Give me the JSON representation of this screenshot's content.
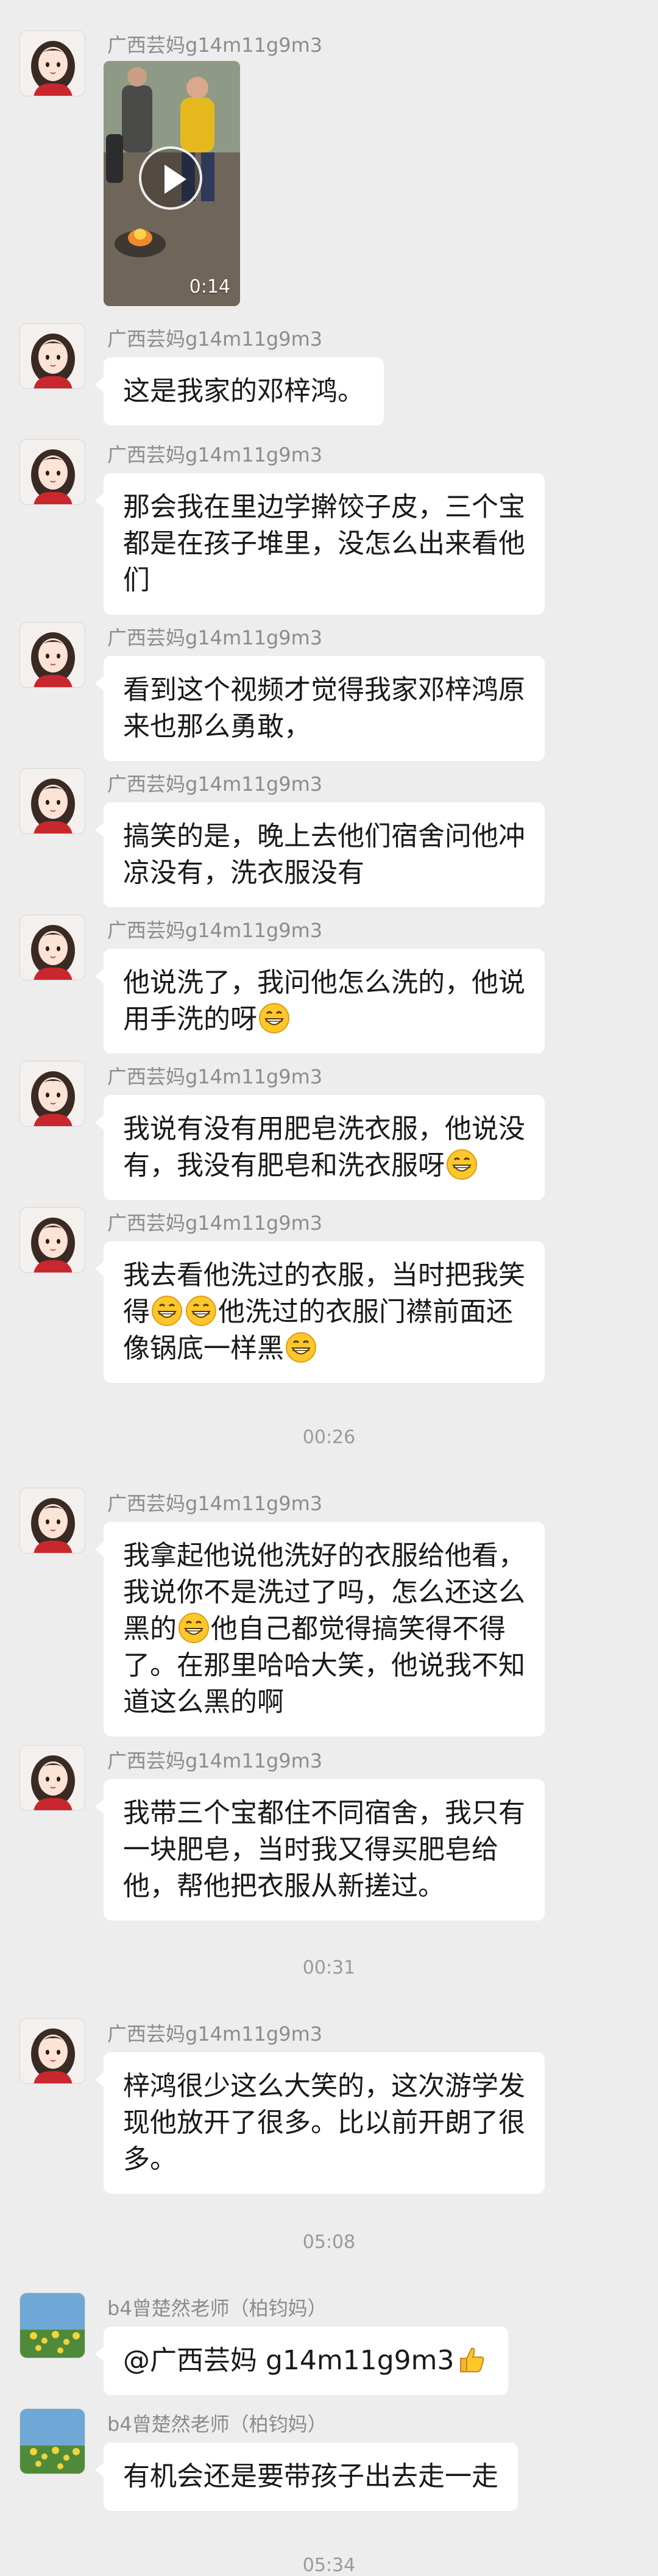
{
  "chat": {
    "background": "#ededed",
    "messages": [
      {
        "type": "video",
        "sender": "广西芸妈g14m11g9m3",
        "duration": "0:14"
      },
      {
        "type": "text",
        "sender": "广西芸妈g14m11g9m3",
        "lines": [
          "这是我家的邓梓鸿。"
        ]
      },
      {
        "type": "text",
        "sender": "广西芸妈g14m11g9m3",
        "lines": [
          "那会我在里边学擀饺子皮，三个宝",
          "都是在孩子堆里，没怎么出来看他",
          "们"
        ]
      },
      {
        "type": "text",
        "sender": "广西芸妈g14m11g9m3",
        "lines": [
          "看到这个视频才觉得我家邓梓鸿原",
          "来也那么勇敢，"
        ]
      },
      {
        "type": "text",
        "sender": "广西芸妈g14m11g9m3",
        "lines": [
          "搞笑的是，晚上去他们宿舍问他冲",
          "凉没有，洗衣服没有"
        ]
      },
      {
        "type": "text",
        "sender": "广西芸妈g14m11g9m3",
        "lines": [
          "他说洗了，我问他怎么洗的，他说",
          "用手洗的呀"
        ]
      },
      {
        "type": "text",
        "sender": "广西芸妈g14m11g9m3",
        "lines": [
          "我说有没有用肥皂洗衣服，他说没",
          "有，我没有肥皂和洗衣服呀"
        ]
      },
      {
        "type": "text",
        "sender": "广西芸妈g14m11g9m3",
        "lines": [
          "我去看他洗过的衣服，当时把我笑",
          "得",
          "他洗过的衣服门襟前面还",
          "像锅底一样黑"
        ]
      },
      {
        "type": "time",
        "text": "00:26"
      },
      {
        "type": "text",
        "sender": "广西芸妈g14m11g9m3",
        "lines": [
          "我拿起他说他洗好的衣服给他看，",
          "我说你不是洗过了吗，怎么还这么",
          "黑的",
          "他自己都觉得搞笑得不得",
          "了。在那里哈哈大笑，他说我不知",
          "道这么黑的啊"
        ]
      },
      {
        "type": "text",
        "sender": "广西芸妈g14m11g9m3",
        "lines": [
          "我带三个宝都住不同宿舍，我只有",
          "一块肥皂，当时我又得买肥皂给",
          "他，帮他把衣服从新搓过。"
        ]
      },
      {
        "type": "time",
        "text": "00:31"
      },
      {
        "type": "text",
        "sender": "广西芸妈g14m11g9m3",
        "lines": [
          "梓鸿很少这么大笑的，这次游学发",
          "现他放开了很多。比以前开朗了很",
          "多。"
        ]
      },
      {
        "type": "time",
        "text": "05:08"
      },
      {
        "type": "text",
        "sender": "b4曾楚然老师（柏钧妈）",
        "lines": [
          "@广西芸妈 g14m11g9m3"
        ]
      },
      {
        "type": "text",
        "sender": "b4曾楚然老师（柏钧妈）",
        "lines": [
          "有机会还是要带孩子出去走一走"
        ]
      },
      {
        "type": "time",
        "text": "05:34"
      }
    ]
  }
}
